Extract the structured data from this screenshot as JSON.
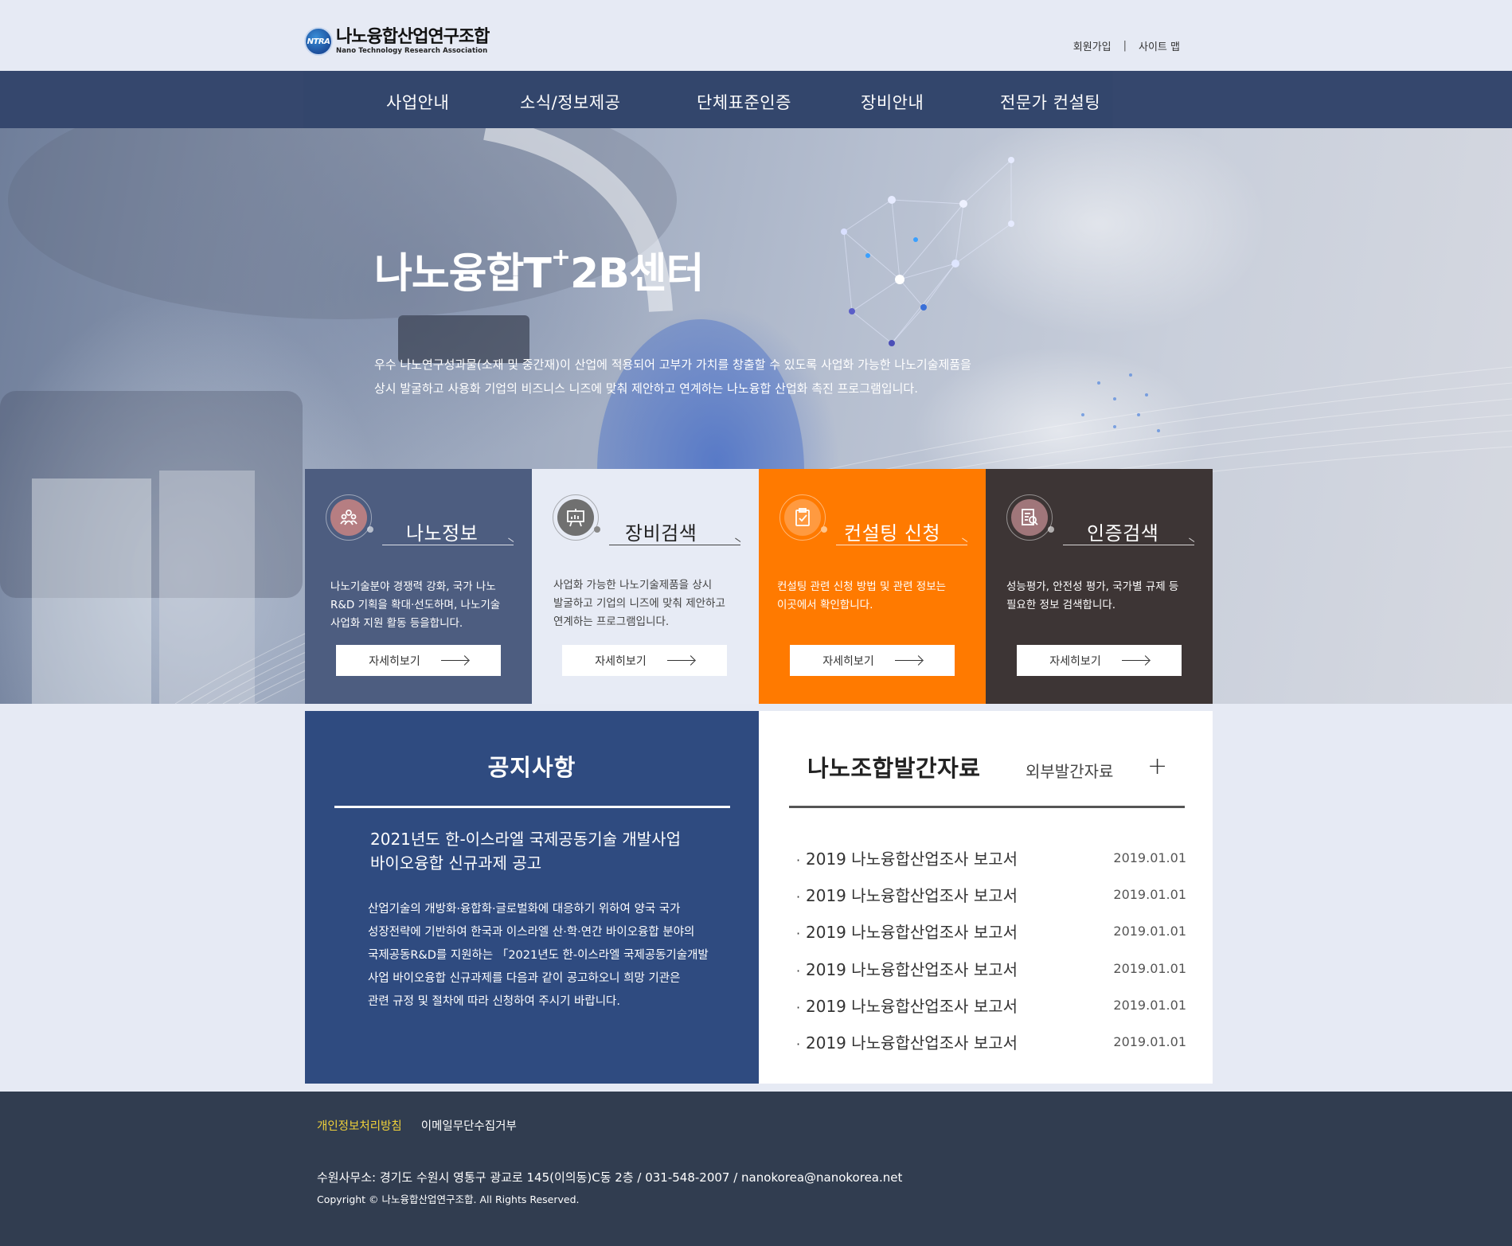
{
  "header": {
    "logo_ko": "나노융합산업연구조합",
    "logo_en": "Nano Technology Research Association",
    "logo_mark": "NTRA",
    "util_links": [
      "회원가입",
      "사이트 맵"
    ],
    "util_sep": "|"
  },
  "nav": {
    "items": [
      "사업안내",
      "소식/정보제공",
      "단체표준인증",
      "장비안내",
      "전문가 컨설팅"
    ]
  },
  "hero": {
    "title_main": "나노융합T",
    "title_sup": "+",
    "title_end": "2B센터",
    "desc_line1": "우수 나노연구성과물(소재 및 중간재)이 산업에 적용되어 고부가 가치를 창출할 수 있도록 사업화 가능한 나노기술제품을",
    "desc_line2": "상시 발굴하고 사용화 기업의 비즈니스 니즈에 맞춰 제안하고 연계하는 나노융합 산업화 촉진 프로그램입니다."
  },
  "cards": [
    {
      "title": "나노정보",
      "icon": "people-icon",
      "desc": [
        "나노기술분야 경쟁력 강화, 국가 나노",
        "R&D 기획을 확대·선도하며, 나노기술",
        "사업화 지원 활동 등을합니다."
      ],
      "button": "자세히보기",
      "color": "#4d5d80"
    },
    {
      "title": "장비검색",
      "icon": "presentation-board-icon",
      "desc": [
        "사업화 가능한 나노기술제품을 상시",
        "발굴하고 기업의 니즈에 맞춰 제안하고",
        "연계하는 프로그램입니다."
      ],
      "button": "자세히보기",
      "color": "#e7ebf5"
    },
    {
      "title": "컨설팅 신청",
      "icon": "clipboard-check-icon",
      "desc": [
        "컨설팅 관련 신청 방법 및 관련 정보는",
        "이곳에서 확인합니다."
      ],
      "button": "자세히보기",
      "color": "#ff7a00"
    },
    {
      "title": "인증검색",
      "icon": "document-search-icon",
      "desc": [
        "성능평가, 안전성 평가, 국가별 규제 등",
        "필요한 정보 검색합니다."
      ],
      "button": "자세히보기",
      "color": "#3d3535"
    }
  ],
  "notice": {
    "title": "공지사항",
    "headline": [
      "2021년도 한-이스라엘 국제공동기술 개발사업",
      "바이오융합 신규과제 공고"
    ],
    "body": [
      "산업기술의 개방화·융합화·글로벌화에 대응하기 위하여 양국 국가",
      "성장전략에 기반하여 한국과 이스라엘 산·학·연간 바이오융합 분야의",
      "국제공동R&D를 지원하는 「2021년도 한-이스라엘 국제공동기술개발",
      "사업 바이오융합 신규과제를 다음과 같이 공고하오니 희망 기관은",
      "관련 규정 및 절차에 따라 신청하여 주시기 바랍니다."
    ]
  },
  "publications": {
    "title": "나노조합발간자료",
    "external": "외부발간자료",
    "more": "+",
    "bullet": "·",
    "items": [
      {
        "name": "2019 나노융합산업조사 보고서",
        "date": "2019.01.01"
      },
      {
        "name": "2019 나노융합산업조사 보고서",
        "date": "2019.01.01"
      },
      {
        "name": "2019 나노융합산업조사 보고서",
        "date": "2019.01.01"
      },
      {
        "name": "2019 나노융합산업조사 보고서",
        "date": "2019.01.01"
      },
      {
        "name": "2019 나노융합산업조사 보고서",
        "date": "2019.01.01"
      },
      {
        "name": "2019 나노융합산업조사 보고서",
        "date": "2019.01.01"
      }
    ]
  },
  "footer": {
    "privacy": "개인정보처리방침",
    "email_refusal": "이메일무단수집거부",
    "address": "수원사무소: 경기도 수원시 영통구 광교로 145(이의동)C동 2층 / 031-548-2007 / nanokorea@nanokorea.net",
    "copyright": "Copyright © 나노융합산업연구조합. All Rights Reserved."
  }
}
